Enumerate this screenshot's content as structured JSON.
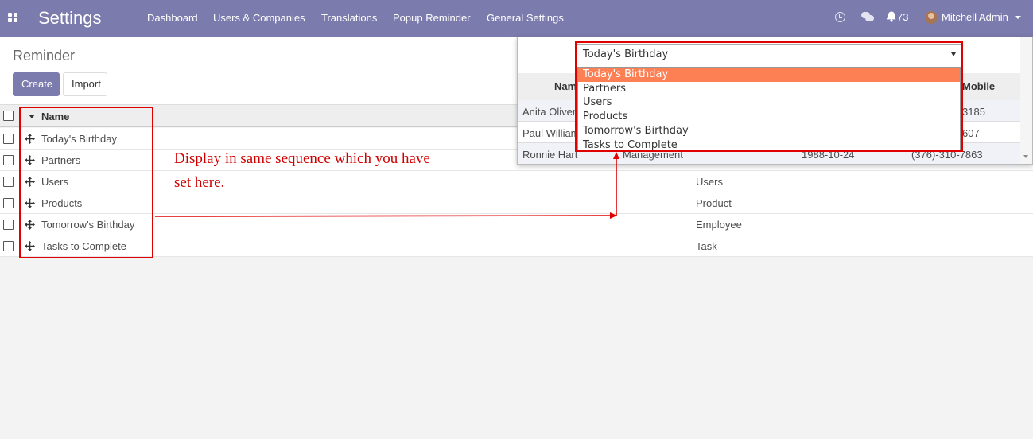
{
  "navbar": {
    "brand": "Settings",
    "menu": [
      "Dashboard",
      "Users & Companies",
      "Translations",
      "Popup Reminder",
      "General Settings"
    ],
    "notification_count": "73",
    "user_name": "Mitchell Admin",
    "color": "#7c7bad"
  },
  "control_panel": {
    "breadcrumb": "Reminder",
    "create_label": "Create",
    "import_label": "Import"
  },
  "list": {
    "column_name": "Name",
    "rows": [
      {
        "name": "Today's Birthday",
        "model": ""
      },
      {
        "name": "Partners",
        "model": ""
      },
      {
        "name": "Users",
        "model": "Users"
      },
      {
        "name": "Products",
        "model": "Product"
      },
      {
        "name": "Tomorrow's Birthday",
        "model": "Employee"
      },
      {
        "name": "Tasks to Complete",
        "model": "Task"
      }
    ]
  },
  "annotation": {
    "line1": "Display in same sequence which you have",
    "line2": "set here.",
    "color": "#e00000"
  },
  "popup": {
    "selected_value": "Today's Birthday",
    "header_name": "Nam",
    "header_mobile": "Mobile",
    "options": [
      "Today's Birthday",
      "Partners",
      "Users",
      "Products",
      "Tomorrow's Birthday",
      "Tasks to Complete"
    ],
    "highlight_color": "#fd7f54",
    "rows": [
      {
        "name": "Anita Oliver",
        "job": "",
        "birthday": "",
        "mobile": "3185"
      },
      {
        "name": "Paul William",
        "job": "",
        "birthday": "",
        "mobile": "607"
      },
      {
        "name": "Ronnie Hart",
        "job": "Management",
        "birthday": "1988-10-24",
        "mobile": "(376)-310-7863"
      }
    ]
  }
}
